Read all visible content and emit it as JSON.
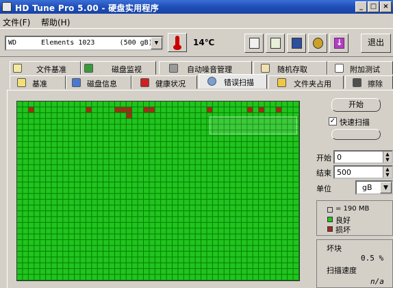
{
  "window": {
    "title": "HD Tune Pro 5.00 - 硬盘实用程序",
    "controls": {
      "minimize": "_",
      "maximize": "□",
      "close": "×"
    }
  },
  "menu": [
    {
      "label": "文件(F)"
    },
    {
      "label": "帮助(H)"
    }
  ],
  "toolbar": {
    "drive": "WD      Elements 1023      (500 gB)",
    "temperature": "14℃",
    "exit_label": "退出",
    "icons": [
      "thermometer-icon",
      "copy-icon",
      "copy-all-icon",
      "save-icon",
      "options-icon",
      "download-icon"
    ]
  },
  "tabs_row1": [
    {
      "label": "文件基准",
      "icon": "file-benchmark-icon"
    },
    {
      "label": "磁盘监视",
      "icon": "disk-monitor-icon"
    },
    {
      "label": "自动噪音管理",
      "icon": "speaker-icon"
    },
    {
      "label": "随机存取",
      "icon": "random-access-icon"
    },
    {
      "label": "附加测试",
      "icon": "extra-tests-icon"
    }
  ],
  "tabs_row2": [
    {
      "label": "基准",
      "icon": "benchmark-icon"
    },
    {
      "label": "磁盘信息",
      "icon": "info-icon"
    },
    {
      "label": "健康状况",
      "icon": "health-icon"
    },
    {
      "label": "错误扫描",
      "icon": "search-icon",
      "active": true
    },
    {
      "label": "文件夹占用",
      "icon": "folder-icon"
    },
    {
      "label": "擦除",
      "icon": "erase-icon"
    }
  ],
  "scan": {
    "grid_columns": 49,
    "grid_rows": 31,
    "damaged_blocks": [
      [
        1,
        2
      ],
      [
        1,
        12
      ],
      [
        1,
        17
      ],
      [
        1,
        18
      ],
      [
        1,
        19
      ],
      [
        2,
        19
      ],
      [
        1,
        22
      ],
      [
        1,
        23
      ],
      [
        1,
        33
      ],
      [
        1,
        40
      ],
      [
        1,
        42
      ],
      [
        1,
        45
      ]
    ],
    "colors": {
      "good": "#22c31f",
      "damaged": "#a52a1a",
      "grid_line": "#0a5a0a"
    }
  },
  "controls": {
    "start_button": "开始",
    "quick_scan_label": "快速扫描",
    "quick_scan_checked": true,
    "start_label": "开始",
    "start_value": "0",
    "end_label": "结束",
    "end_value": "500",
    "unit_label": "单位",
    "unit_value": "gB"
  },
  "legend": {
    "block_size": "= 190 MB",
    "good": "良好",
    "damaged": "损坏"
  },
  "stats": {
    "damaged_blocks_label": "坏块",
    "damaged_blocks_value": "0.5 %",
    "scan_speed_label": "扫描速度",
    "scan_speed_value": "n/a"
  }
}
